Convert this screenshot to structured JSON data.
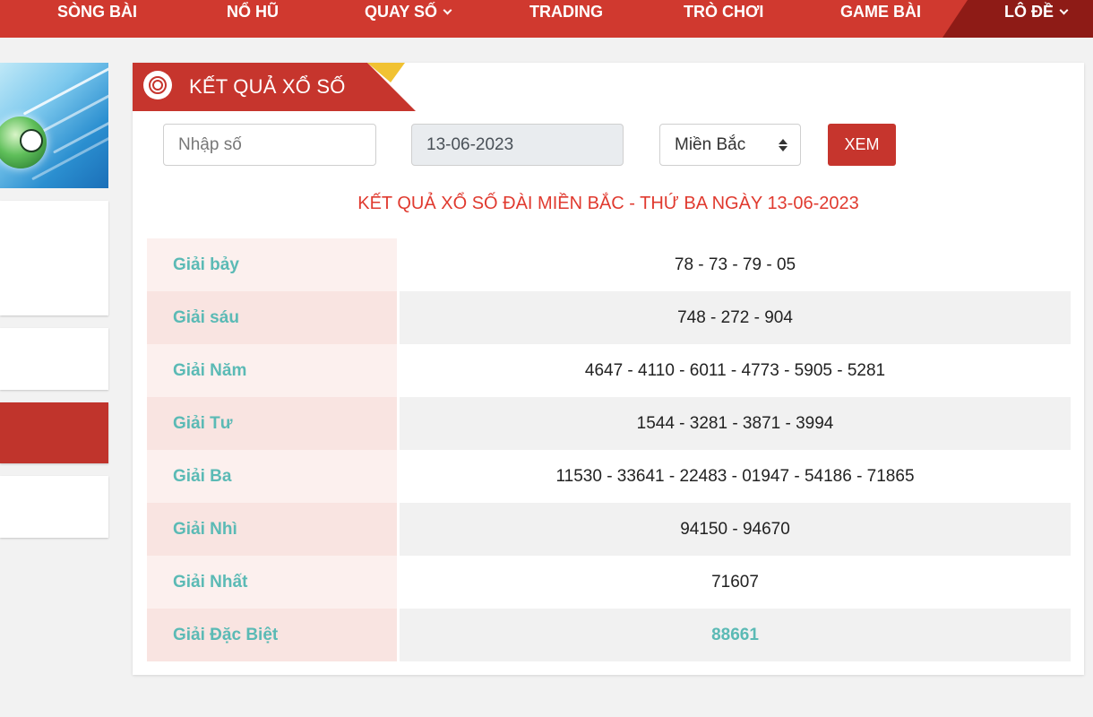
{
  "nav": {
    "items": [
      {
        "label": "SÒNG BÀI"
      },
      {
        "label": "NỔ HŨ"
      },
      {
        "label": "QUAY SỐ"
      },
      {
        "label": "TRADING"
      },
      {
        "label": "TRÒ CHƠI"
      },
      {
        "label": "GAME BÀI"
      },
      {
        "label": "LÔ ĐỀ"
      }
    ]
  },
  "panel": {
    "title": "KẾT QUẢ XỔ SỐ",
    "search_placeholder": "Nhập số",
    "date_value": "13-06-2023",
    "region_selected": "Miền Bắc",
    "submit_label": "XEM",
    "result_title": "KẾT QUẢ XỔ SỐ ĐÀI MIỀN BẮC - THỨ BA NGÀY 13-06-2023"
  },
  "results": [
    {
      "label": "Giải bảy",
      "value": "78 - 73 - 79 - 05"
    },
    {
      "label": "Giải sáu",
      "value": "748 - 272 - 904"
    },
    {
      "label": "Giải Năm",
      "value": "4647 - 4110 - 6011 - 4773 - 5905 - 5281"
    },
    {
      "label": "Giải Tư",
      "value": "1544 - 3281 - 3871 - 3994"
    },
    {
      "label": "Giải Ba",
      "value": "11530 - 33641 - 22483 - 01947 - 54186 - 71865"
    },
    {
      "label": "Giải Nhì",
      "value": "94150 - 94670"
    },
    {
      "label": "Giải Nhất",
      "value": "71607"
    },
    {
      "label": "Giải Đặc Biệt",
      "value": "88661"
    }
  ],
  "colors": {
    "brand_red": "#d0392f",
    "accent_teal": "#5bbab5",
    "result_title_red": "#e03a2f"
  }
}
